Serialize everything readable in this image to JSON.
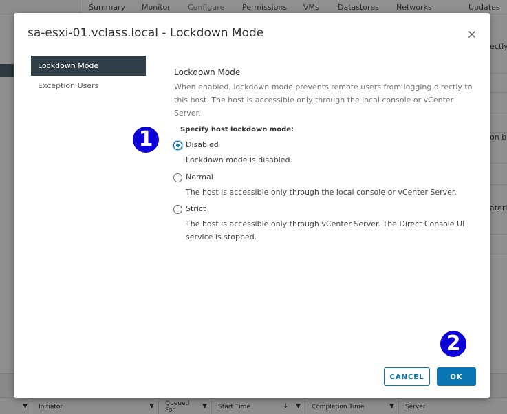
{
  "background": {
    "tabs": [
      "Summary",
      "Monitor",
      "Configure",
      "Permissions",
      "VMs",
      "Datastores",
      "Networks",
      "Updates"
    ],
    "right_fragments": [
      "ectly",
      "on bu",
      "ateri"
    ],
    "table_columns": [
      "Initiator",
      "Queued For",
      "Start Time",
      "Completion Time",
      "Server"
    ],
    "filter_glyph": "▼",
    "sort_glyph": "↓"
  },
  "dialog": {
    "title": "sa-esxi-01.vclass.local - Lockdown Mode",
    "close_icon": "close-icon",
    "nav": [
      {
        "label": "Lockdown Mode",
        "active": true
      },
      {
        "label": "Exception Users",
        "active": false
      }
    ],
    "section_title": "Lockdown Mode",
    "section_desc": "When enabled, lockdown mode prevents remote users from logging directly to this host. The host is accessible only through the local console or vCenter Server.",
    "mode_label": "Specify host lockdown mode:",
    "options": [
      {
        "label": "Disabled",
        "desc": "Lockdown mode is disabled.",
        "checked": true
      },
      {
        "label": "Normal",
        "desc": "The host is accessible only through the local console or vCenter Server.",
        "checked": false
      },
      {
        "label": "Strict",
        "desc": "The host is accessible only through vCenter Server. The Direct Console UI service is stopped.",
        "checked": false
      }
    ],
    "cancel_label": "CANCEL",
    "ok_label": "OK"
  },
  "annotations": [
    "1",
    "2"
  ],
  "colors": {
    "primary": "#0a76b4",
    "nav_active": "#2f3e47",
    "badge": "#0d00d8"
  }
}
